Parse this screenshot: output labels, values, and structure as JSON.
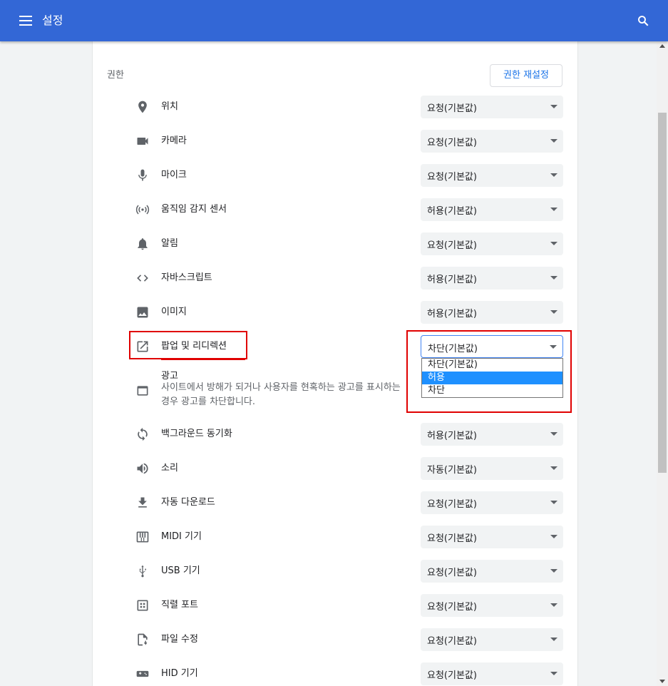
{
  "header": {
    "title": "설정",
    "menu_icon": "menu-icon",
    "search_icon": "search-icon",
    "color": "#3367d6"
  },
  "permissions": {
    "section_title": "권한",
    "reset_label": "권한 재설정",
    "rows": [
      {
        "label": "위치",
        "value": "요청(기본값)",
        "icon": "location-icon"
      },
      {
        "label": "카메라",
        "value": "요청(기본값)",
        "icon": "camera-icon"
      },
      {
        "label": "마이크",
        "value": "요청(기본값)",
        "icon": "microphone-icon"
      },
      {
        "label": "움직임 감지 센서",
        "value": "허용(기본값)",
        "icon": "sensor-icon"
      },
      {
        "label": "알림",
        "value": "요청(기본값)",
        "icon": "bell-icon"
      },
      {
        "label": "자바스크립트",
        "value": "허용(기본값)",
        "icon": "code-icon"
      },
      {
        "label": "이미지",
        "value": "허용(기본값)",
        "icon": "image-icon"
      },
      {
        "label": "팝업 및 리디렉션",
        "value": "차단(기본값)",
        "icon": "open-in-new-icon"
      }
    ],
    "ads": {
      "title": "광고",
      "description": "사이트에서 방해가 되거나 사용자를 현혹하는 광고를 표시하는 경우 광고를 차단합니다.",
      "icon": "web-asset-icon"
    },
    "rows_after": [
      {
        "label": "백그라운드 동기화",
        "value": "허용(기본값)",
        "icon": "sync-icon"
      },
      {
        "label": "소리",
        "value": "자동(기본값)",
        "icon": "volume-icon"
      },
      {
        "label": "자동 다운로드",
        "value": "요청(기본값)",
        "icon": "download-icon"
      },
      {
        "label": "MIDI 기기",
        "value": "요청(기본값)",
        "icon": "piano-icon"
      },
      {
        "label": "USB 기기",
        "value": "요청(기본값)",
        "icon": "usb-icon"
      },
      {
        "label": "직렬 포트",
        "value": "요청(기본값)",
        "icon": "serial-port-icon"
      },
      {
        "label": "파일 수정",
        "value": "요청(기본값)",
        "icon": "file-edit-icon"
      },
      {
        "label": "HID 기기",
        "value": "요청(기본값)",
        "icon": "gamepad-icon"
      }
    ],
    "popup_dropdown": {
      "options": [
        "차단(기본값)",
        "허용",
        "차단"
      ],
      "highlighted": "허용"
    }
  },
  "colors": {
    "highlight_box": "#e00000",
    "dropdown_highlight": "#1e90ff",
    "link": "#1a73e8"
  }
}
